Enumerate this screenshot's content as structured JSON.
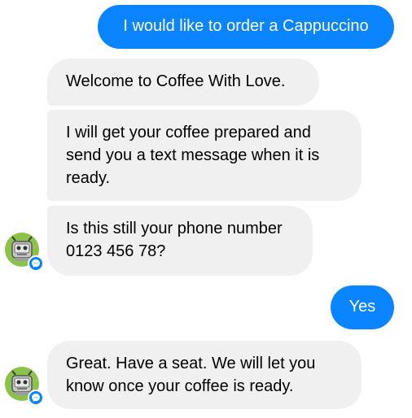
{
  "conversation": {
    "messages": [
      {
        "sender": "user",
        "text": "I would like to order a Cappuccino"
      },
      {
        "sender": "bot",
        "text": "Welcome to Coffee With Love."
      },
      {
        "sender": "bot",
        "text": "I will get your coffee prepared and\nsend you a text message when it is\nready."
      },
      {
        "sender": "bot",
        "text": "Is this still your phone number\n0123 456 78?"
      },
      {
        "sender": "user",
        "text": "Yes"
      },
      {
        "sender": "bot",
        "text": "Great. Have a seat. We will let you\nknow once your coffee is ready."
      }
    ]
  },
  "bot_avatar": {
    "icon": "robot-avatar-icon",
    "badge_icon": "messenger-icon",
    "background_color": "#8bc34a"
  },
  "colors": {
    "outgoing_bubble": "#0b84ff",
    "incoming_bubble": "#f1f0f0",
    "messenger_badge": "#0084ff"
  }
}
